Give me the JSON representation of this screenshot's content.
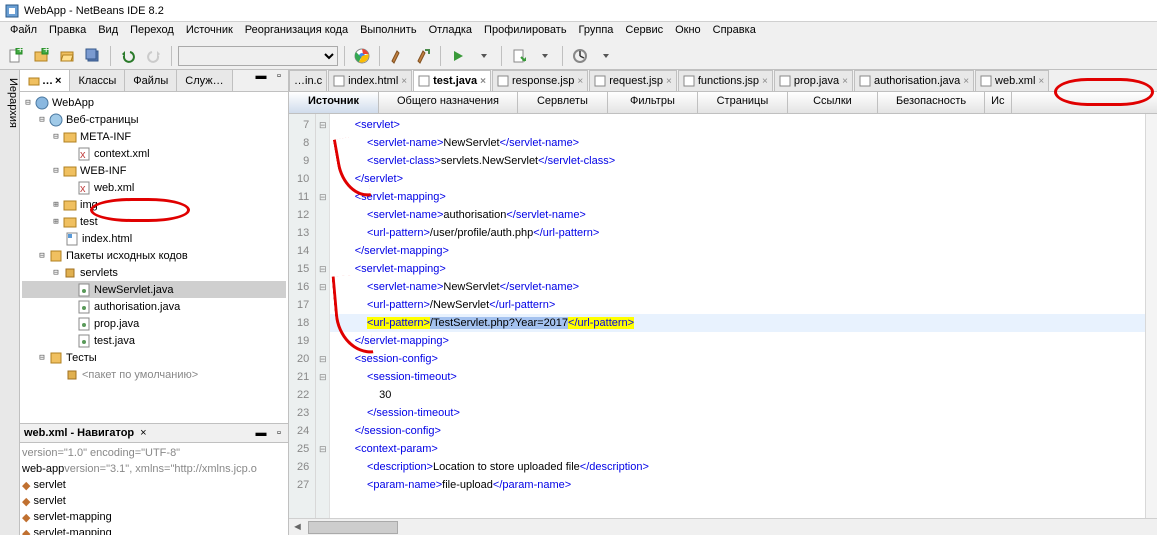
{
  "title": "WebApp - NetBeans IDE 8.2",
  "menu": [
    "Файл",
    "Правка",
    "Вид",
    "Переход",
    "Источник",
    "Реорганизация кода",
    "Выполнить",
    "Отладка",
    "Профилировать",
    "Группа",
    "Сервис",
    "Окно",
    "Справка"
  ],
  "sidetab": "Иерархия",
  "panetabs": {
    "active": "…",
    "t1": "Классы",
    "t2": "Файлы",
    "t3": "Служ…"
  },
  "tree": {
    "root": "WebApp",
    "webpages": "Веб-страницы",
    "meta": "META-INF",
    "context": "context.xml",
    "webinf": "WEB-INF",
    "webxml": "web.xml",
    "img": "img",
    "test": "test",
    "indexhtml": "index.html",
    "srcpkg": "Пакеты исходных кодов",
    "servlets": "servlets",
    "newserv": "NewServlet.java",
    "auth": "authorisation.java",
    "prop": "prop.java",
    "testj": "test.java",
    "tests": "Тесты",
    "defpkg": "<пакет по умолчанию>"
  },
  "nav": {
    "title": "web.xml - Навигатор",
    "l0a": "version=\"1.0\" encoding=\"UTF-8\"",
    "l1": "web-app ",
    "l1g": "version=\"3.1\", xmlns=\"http://xmlns.jcp.o",
    "l2": "servlet",
    "l3": "servlet",
    "l4": "servlet-mapping",
    "l5": "servlet-mapping"
  },
  "etabs": {
    "t0": "…in.c",
    "t1": "index.html",
    "t2": "test.java",
    "t3": "response.jsp",
    "t4": "request.jsp",
    "t5": "functions.jsp",
    "t6": "prop.java",
    "t7": "authorisation.java",
    "t8": "web.xml"
  },
  "subtabs": [
    "Источник",
    "Общего назначения",
    "Сервлеты",
    "Фильтры",
    "Страницы",
    "Ссылки",
    "Безопасность",
    "Ис"
  ],
  "lines": [
    7,
    8,
    9,
    10,
    11,
    12,
    13,
    14,
    15,
    16,
    17,
    18,
    19,
    20,
    21,
    22,
    23,
    24,
    25,
    26,
    27
  ],
  "code": {
    "l7": {
      "ind": "        ",
      "t": "<servlet>"
    },
    "l8": {
      "ind": "            ",
      "o": "<servlet-name>",
      "x": "NewServlet",
      "c": "</servlet-name>"
    },
    "l9": {
      "ind": "            ",
      "o": "<servlet-class>",
      "x": "servlets.NewServlet",
      "c": "</servlet-class>"
    },
    "l10": {
      "ind": "        ",
      "t": "</servlet>"
    },
    "l11": {
      "ind": "        ",
      "t": "<servlet-mapping>"
    },
    "l12": {
      "ind": "            ",
      "o": "<servlet-name>",
      "x": "authorisation",
      "c": "</servlet-name>"
    },
    "l13": {
      "ind": "            ",
      "o": "<url-pattern>",
      "x": "/user/profile/auth.php",
      "c": "</url-pattern>"
    },
    "l14": {
      "ind": "        ",
      "t": "</servlet-mapping>"
    },
    "l15": {
      "ind": "        ",
      "t": "<servlet-mapping>"
    },
    "l16": {
      "ind": "            ",
      "o": "<servlet-name>",
      "x": "NewServlet",
      "c": "</servlet-name>"
    },
    "l17": {
      "ind": "            ",
      "o": "<url-pattern>",
      "x": "/NewServlet",
      "c": "</url-pattern>"
    },
    "l18": {
      "ind": "            ",
      "o": "<url-pattern>",
      "x": "/TestServlet.php?Year=2017",
      "c": "</url-pattern>"
    },
    "l19": {
      "ind": "        ",
      "t": "</servlet-mapping>"
    },
    "l20": {
      "ind": "        ",
      "t": "<session-config>"
    },
    "l21": {
      "ind": "            ",
      "t": "<session-timeout>"
    },
    "l22": {
      "ind": "                ",
      "x": "30"
    },
    "l23": {
      "ind": "            ",
      "t": "</session-timeout>"
    },
    "l24": {
      "ind": "        ",
      "t": "</session-config>"
    },
    "l25": {
      "ind": "        ",
      "t": "<context-param>"
    },
    "l26": {
      "ind": "            ",
      "o": "<description>",
      "x": "Location to store uploaded file",
      "c": "</description>"
    },
    "l27": {
      "ind": "            ",
      "o": "<param-name>",
      "x": "file-upload",
      "c": "</param-name>"
    }
  }
}
